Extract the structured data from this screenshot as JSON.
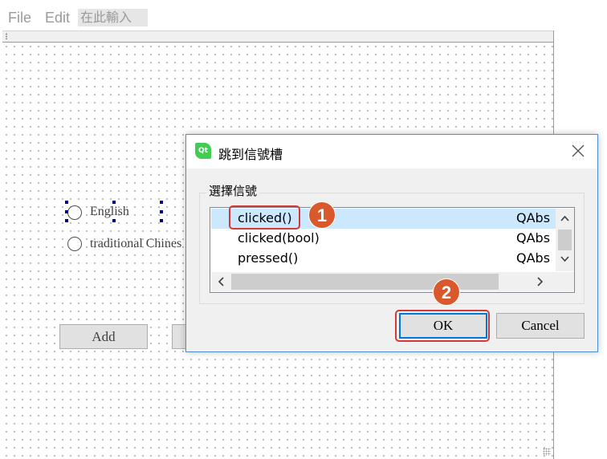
{
  "menubar": {
    "items": [
      "File",
      "Edit"
    ],
    "input_placeholder": "在此輸入"
  },
  "form": {
    "radio_english": "English",
    "radio_chinese": "traditional Chines",
    "add_button": "Add"
  },
  "dialog": {
    "logo_text": "Qt",
    "title": "跳到信號槽",
    "group_title": "選擇信號",
    "signals": [
      {
        "name": "clicked()",
        "class": "QAbs",
        "selected": true
      },
      {
        "name": "clicked(bool)",
        "class": "QAbs",
        "selected": false
      },
      {
        "name": "pressed()",
        "class": "QAbs",
        "selected": false
      }
    ],
    "ok_label": "OK",
    "cancel_label": "Cancel"
  },
  "annotations": {
    "badge_1": "1",
    "badge_2": "2",
    "color": "#d9582c"
  },
  "colors": {
    "selection": "#cce8ff",
    "dialog_border": "#4a90d9",
    "qt_green": "#41cd52",
    "annotation_outline": "#d03a3a"
  }
}
